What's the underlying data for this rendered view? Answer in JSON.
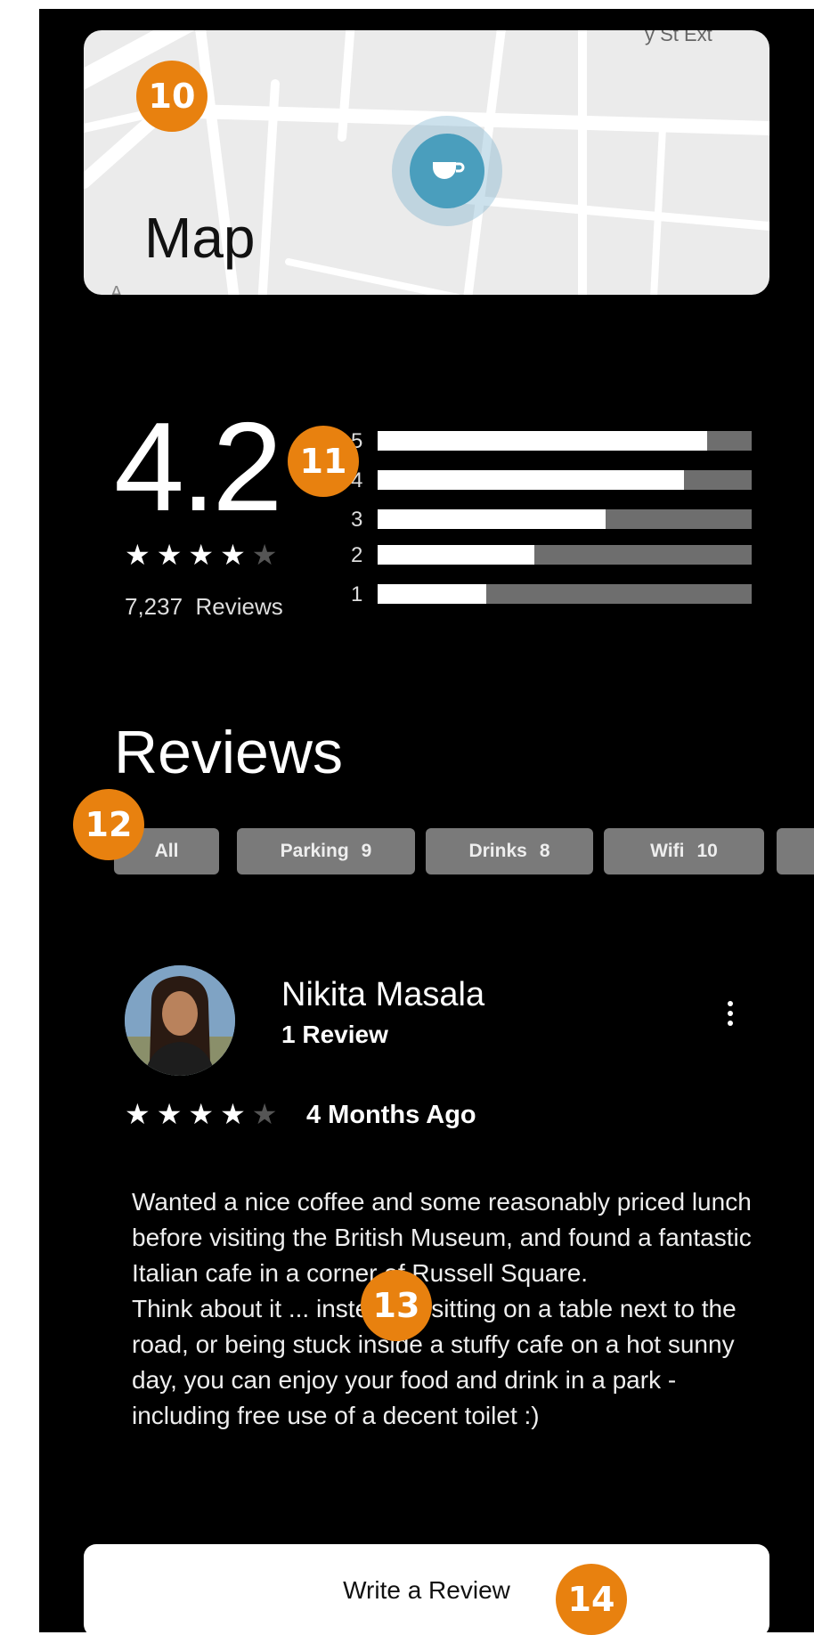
{
  "map": {
    "title": "Map",
    "corner_text": "y St Ext",
    "bottom_text": "A ...",
    "pin_icon": "coffee-cup-icon",
    "pin_color": "#4a9ebd"
  },
  "rating": {
    "score": "4.2",
    "stars": {
      "filled": "★★★★",
      "empty": "★",
      "value": 4,
      "max": 5
    },
    "count": "7,237",
    "count_label": "Reviews",
    "distribution": [
      {
        "label": "5",
        "fraction": 0.88
      },
      {
        "label": "4",
        "fraction": 0.82
      },
      {
        "label": "3",
        "fraction": 0.61
      },
      {
        "label": "2",
        "fraction": 0.42
      },
      {
        "label": "1",
        "fraction": 0.29
      }
    ],
    "bar_fill_color": "#ffffff",
    "bar_track_color": "#6e6e6e"
  },
  "reviews": {
    "title": "Reviews",
    "filters": [
      {
        "label": "All",
        "count": ""
      },
      {
        "label": "Parking",
        "count": "9"
      },
      {
        "label": "Drinks",
        "count": "8"
      },
      {
        "label": "Wifi",
        "count": "10"
      }
    ],
    "items": [
      {
        "name": "Nikita Masala",
        "review_count": "1 Review",
        "stars": {
          "filled": "★★★★",
          "empty": "★",
          "value": 4,
          "max": 5
        },
        "date": "4 Months Ago",
        "body": "Wanted a nice coffee and some reasonably priced lunch before visiting the British Museum, and found a fantastic Italian cafe in a corner of Russell Square.\nThink about it ... instead of sitting on a table next to the road, or being stuck inside a stuffy cafe on a hot sunny day, you can enjoy your food and drink in a park - including free use of a decent toilet :)",
        "avatar_icon": "user-avatar"
      }
    ],
    "write_button": "Write a Review"
  },
  "annotations": {
    "markers": [
      "10",
      "11",
      "12",
      "13",
      "14"
    ],
    "color": "#e8810f"
  }
}
